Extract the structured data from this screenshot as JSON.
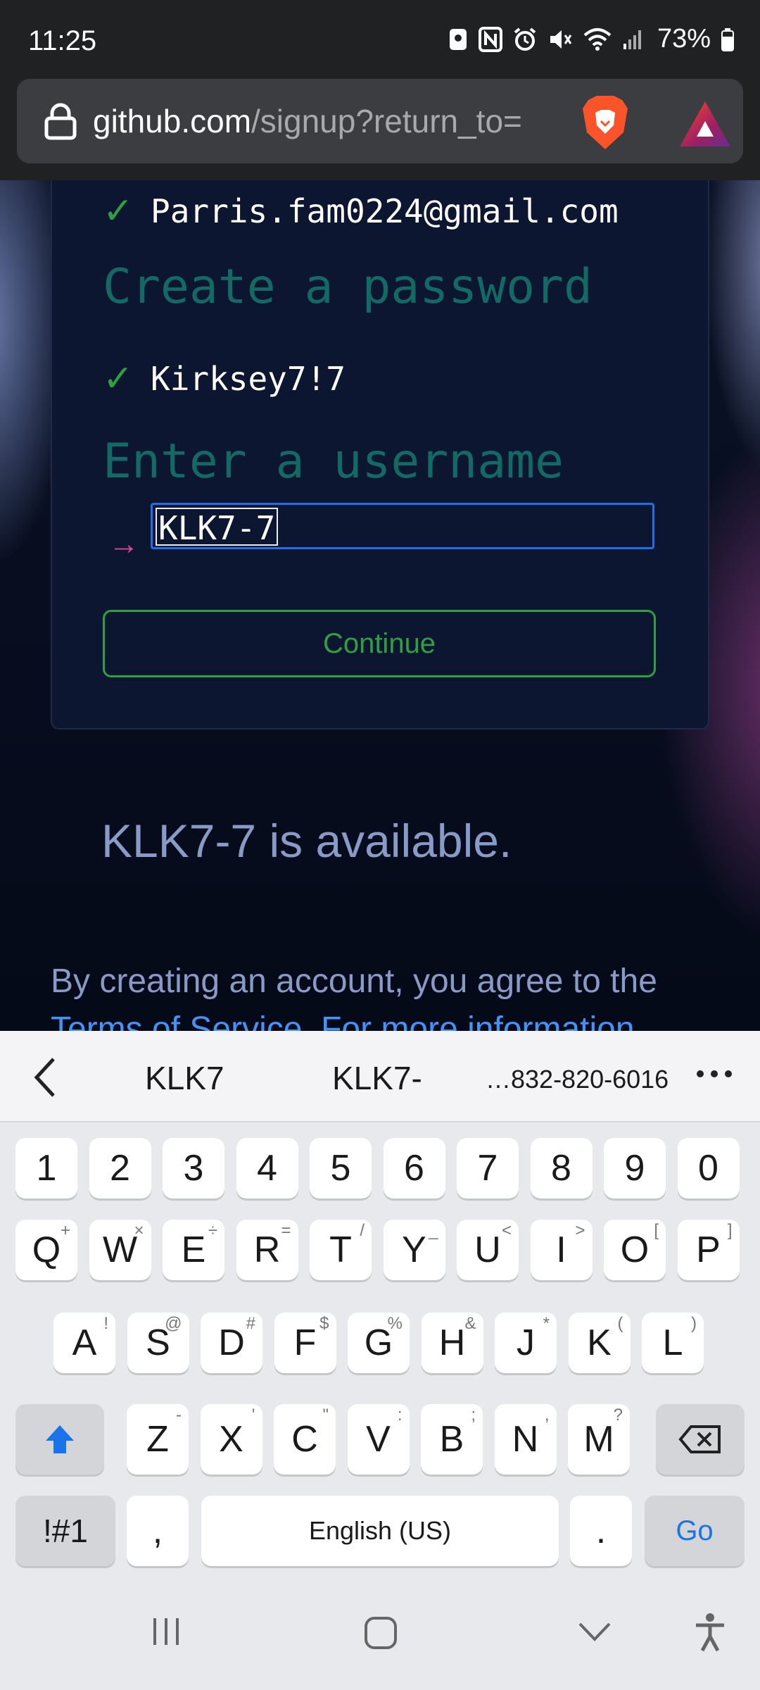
{
  "status_bar": {
    "time": "11:25",
    "battery": "73%"
  },
  "browser": {
    "url_host": "github.com",
    "url_path": "/signup?return_to="
  },
  "form": {
    "email_value": "Parris.fam0224@gmail.com",
    "password_heading": "Create a password",
    "password_value": "Kirksey7!7",
    "username_heading": "Enter a username",
    "username_value": "KLK7-7",
    "continue_label": "Continue"
  },
  "availability_text": "KLK7-7 is available.",
  "terms_text": "By creating an account, you agree to the",
  "terms_link_fragment": "Terms of Service. For more information",
  "keyboard": {
    "suggestions": [
      "KLK7",
      "KLK7-",
      "…832-820-6016"
    ],
    "number_row": [
      "1",
      "2",
      "3",
      "4",
      "5",
      "6",
      "7",
      "8",
      "9",
      "0"
    ],
    "row1": [
      {
        "k": "Q",
        "s": "+"
      },
      {
        "k": "W",
        "s": "×"
      },
      {
        "k": "E",
        "s": "÷"
      },
      {
        "k": "R",
        "s": "="
      },
      {
        "k": "T",
        "s": "/"
      },
      {
        "k": "Y",
        "s": "_"
      },
      {
        "k": "U",
        "s": "<"
      },
      {
        "k": "I",
        "s": ">"
      },
      {
        "k": "O",
        "s": "["
      },
      {
        "k": "P",
        "s": "]"
      }
    ],
    "row2": [
      {
        "k": "A",
        "s": "!"
      },
      {
        "k": "S",
        "s": "@"
      },
      {
        "k": "D",
        "s": "#"
      },
      {
        "k": "F",
        "s": "$"
      },
      {
        "k": "G",
        "s": "%"
      },
      {
        "k": "H",
        "s": "&"
      },
      {
        "k": "J",
        "s": "*"
      },
      {
        "k": "K",
        "s": "("
      },
      {
        "k": "L",
        "s": ")"
      }
    ],
    "row3": [
      {
        "k": "Z",
        "s": "-"
      },
      {
        "k": "X",
        "s": "'"
      },
      {
        "k": "C",
        "s": "\""
      },
      {
        "k": "V",
        "s": ":"
      },
      {
        "k": "B",
        "s": ";"
      },
      {
        "k": "N",
        "s": ","
      },
      {
        "k": "M",
        "s": "?"
      }
    ],
    "symbols_label": "!#1",
    "comma_label": ",",
    "space_label": "English (US)",
    "period_label": ".",
    "go_label": "Go"
  },
  "icons": {
    "status": [
      "sim-icon",
      "nfc-icon",
      "alarm-icon",
      "mute-icon",
      "wifi-icon",
      "signal-icon",
      "battery-icon"
    ],
    "browser": [
      "lock-icon",
      "brave-shield-icon",
      "brave-rewards-icon"
    ],
    "nav": [
      "recents-icon",
      "home-icon",
      "hide-keyboard-icon",
      "accessibility-icon"
    ]
  },
  "colors": {
    "accent_green": "#2ea043",
    "heading_teal": "#136a64",
    "input_blue": "#1f6feb",
    "arrow_pink": "#d9478f",
    "go_blue": "#1a73e8"
  }
}
